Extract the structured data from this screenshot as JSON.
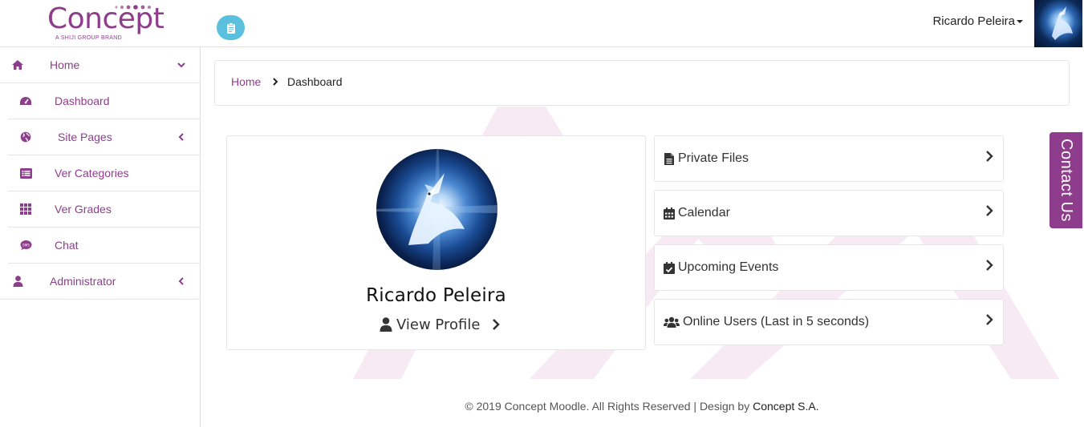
{
  "header": {
    "logo_text": "Concept",
    "logo_sub": "A SHIJI GROUP BRAND",
    "user_name": "Ricardo Peleira",
    "accent": "#8e3d8d"
  },
  "sidebar": {
    "items": [
      {
        "label": "Home",
        "icon": "home-icon"
      },
      {
        "label": "Dashboard",
        "icon": "tachometer-icon"
      },
      {
        "label": "Site Pages",
        "icon": "globe-icon"
      },
      {
        "label": "Ver Categories",
        "icon": "list-icon"
      },
      {
        "label": "Ver Grades",
        "icon": "grid-icon"
      },
      {
        "label": "Chat",
        "icon": "sms-icon"
      },
      {
        "label": "Administrator",
        "icon": "user-icon"
      }
    ]
  },
  "breadcrumb": {
    "home": "Home",
    "current": "Dashboard"
  },
  "profile": {
    "name": "Ricardo Peleira",
    "view_profile": "View Profile"
  },
  "links": [
    {
      "label": "Private Files",
      "icon": "file-icon"
    },
    {
      "label": "Calendar",
      "icon": "calendar-icon"
    },
    {
      "label": "Upcoming Events",
      "icon": "calendar-check-icon"
    },
    {
      "label": "Online Users (Last in 5 seconds)",
      "icon": "users-icon"
    }
  ],
  "contact_tab": "Contact Us",
  "footer": {
    "text": "© 2019 Concept Moodle. All Rights Reserved | Design by ",
    "brand": "Concept S.A."
  }
}
